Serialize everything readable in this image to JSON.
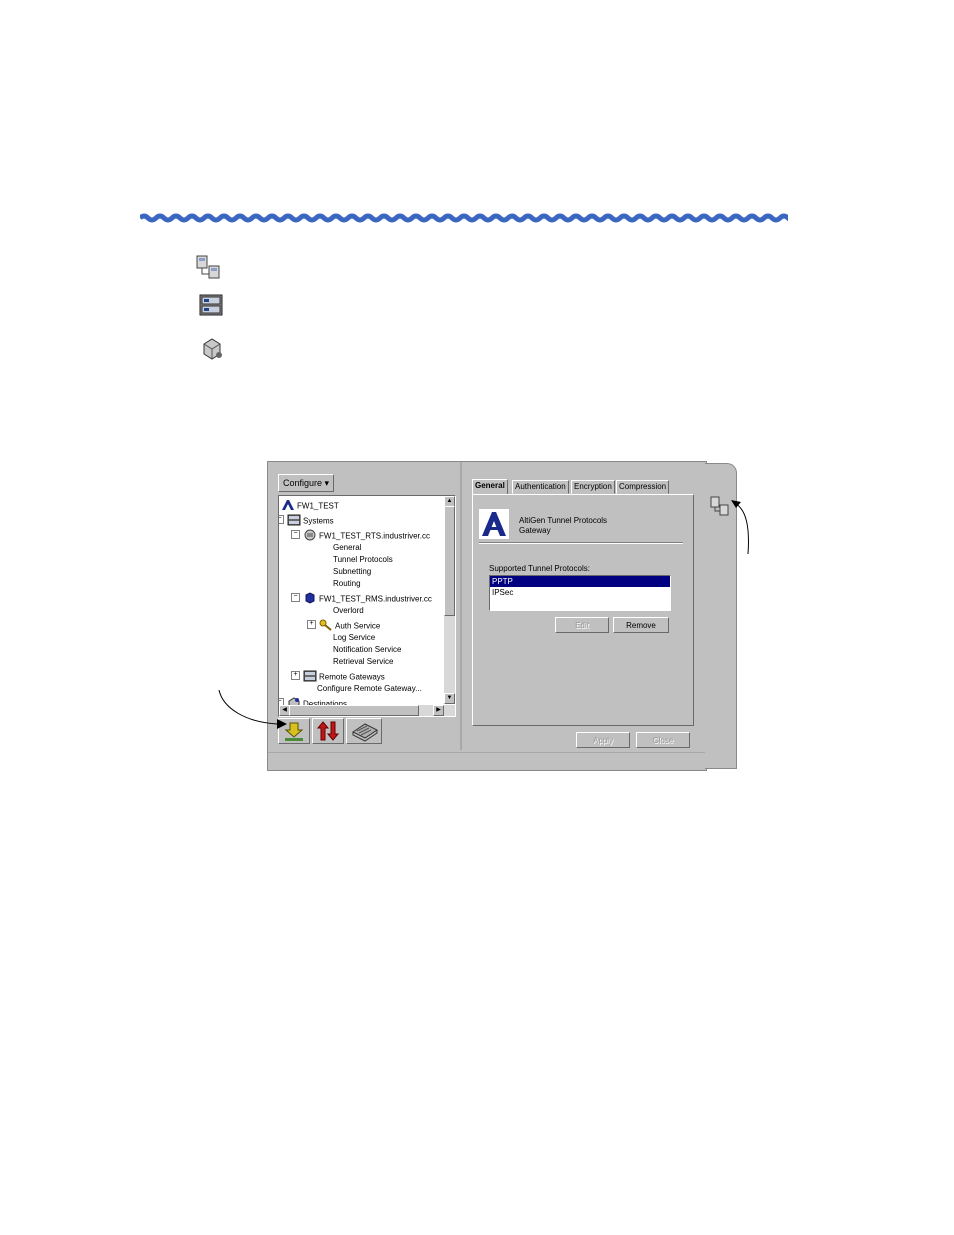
{
  "colors": {
    "wave": "#3a67c0",
    "selection": "#000080",
    "window_bg": "#c0c0c0"
  },
  "legend_icons": [
    "gateway-icon",
    "systems-icon",
    "destination-icon"
  ],
  "left_pane": {
    "configure_label": "Configure ▾",
    "tree": [
      {
        "label": "FW1_TEST",
        "icon": "logo-a-icon",
        "expander": ""
      },
      {
        "label": "Systems",
        "icon": "systems-icon",
        "expander": "-"
      },
      {
        "label": "FW1_TEST_RTS.industriver.cc",
        "icon": "gateway-icon",
        "expander": "-"
      },
      {
        "label": "General",
        "icon": "",
        "expander": ""
      },
      {
        "label": "Tunnel Protocols",
        "icon": "",
        "expander": ""
      },
      {
        "label": "Subnetting",
        "icon": "",
        "expander": ""
      },
      {
        "label": "Routing",
        "icon": "",
        "expander": ""
      },
      {
        "label": "FW1_TEST_RMS.industriver.cc",
        "icon": "rms-icon",
        "expander": "-"
      },
      {
        "label": "Overlord",
        "icon": "",
        "expander": ""
      },
      {
        "label": "Auth Service",
        "icon": "key-icon",
        "expander": "+"
      },
      {
        "label": "Log Service",
        "icon": "",
        "expander": ""
      },
      {
        "label": "Notification Service",
        "icon": "",
        "expander": ""
      },
      {
        "label": "Retrieval Service",
        "icon": "",
        "expander": ""
      },
      {
        "label": "Remote Gateways",
        "icon": "systems-icon",
        "expander": "+"
      },
      {
        "label": "Configure Remote Gateway...",
        "icon": "",
        "expander": ""
      },
      {
        "label": "Destinations",
        "icon": "destination-icon",
        "expander": "-"
      }
    ],
    "bottom_tabs": [
      "download-icon",
      "transfer-icon",
      "network-icon"
    ]
  },
  "right_pane": {
    "tabs": [
      "General",
      "Authentication",
      "Encryption",
      "Compression"
    ],
    "active_tab": "General",
    "gateway_title_line1": "AltiGen Tunnel Protocols",
    "gateway_title_line2": "Gateway",
    "list_label": "Supported Tunnel Protocols:",
    "protocols": [
      "PPTP",
      "IPSec"
    ],
    "selected_protocol": "PPTP",
    "edit_label": "Edit",
    "remove_label": "Remove",
    "apply_label": "Apply",
    "close_label": "Close"
  }
}
